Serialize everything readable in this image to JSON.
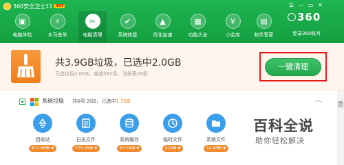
{
  "window": {
    "title": "360安全卫士11",
    "badge": "HOT",
    "controls": [
      "☰",
      "—",
      "▭",
      "✕"
    ]
  },
  "nav": {
    "items": [
      {
        "label": "电脑体检",
        "icon": "pc-check-icon",
        "glyph": "▣",
        "active": false
      },
      {
        "label": "木马查杀",
        "icon": "trojan-scan-icon",
        "glyph": "⚡",
        "active": false
      },
      {
        "label": "电脑清理",
        "icon": "broom-icon",
        "glyph": "✂",
        "active": true
      },
      {
        "label": "系统修复",
        "icon": "shield-icon",
        "glyph": "✔",
        "active": false
      },
      {
        "label": "优化加速",
        "icon": "rocket-icon",
        "glyph": "▲",
        "active": false
      },
      {
        "label": "功能大全",
        "icon": "grid-icon",
        "glyph": "▦",
        "active": false
      },
      {
        "label": "小金库",
        "icon": "wallet-icon",
        "glyph": "¥",
        "active": false
      },
      {
        "label": "软件管家",
        "icon": "software-icon",
        "glyph": "▤",
        "active": false
      }
    ],
    "brand": "360",
    "login_label": "登录360帐号"
  },
  "summary": {
    "headline": "共3.9GB垃圾，已选中2.0GB",
    "detail": "已选垃圾2.0GB，痕迹382条，注册表18条",
    "clean_button": "一键清理"
  },
  "category": {
    "name": "系统垃圾",
    "stats_prefix": "共6项 2GB，已选中",
    "stats_selected": "1.7GB",
    "items": [
      {
        "label": "回收站",
        "size": "872.6MB",
        "icon": "recycle-bin-icon"
      },
      {
        "label": "日志文件",
        "size": "775.3MB",
        "icon": "log-file-icon"
      },
      {
        "label": "系统缓存",
        "size": "67.5MB",
        "icon": "system-cache-icon"
      },
      {
        "label": "临时文件",
        "size": "41MB",
        "icon": "temp-file-icon"
      },
      {
        "label": "系统文件",
        "size": "12.5MB",
        "icon": "folder-icon"
      }
    ]
  },
  "watermark": {
    "title": "百科全说",
    "subtitle": "助你轻松解决"
  },
  "colors": {
    "brand_green": "#1fb551",
    "accent_orange": "#f28b30",
    "item_blue": "#3a9eeb",
    "highlight_red": "#e31b1b"
  }
}
